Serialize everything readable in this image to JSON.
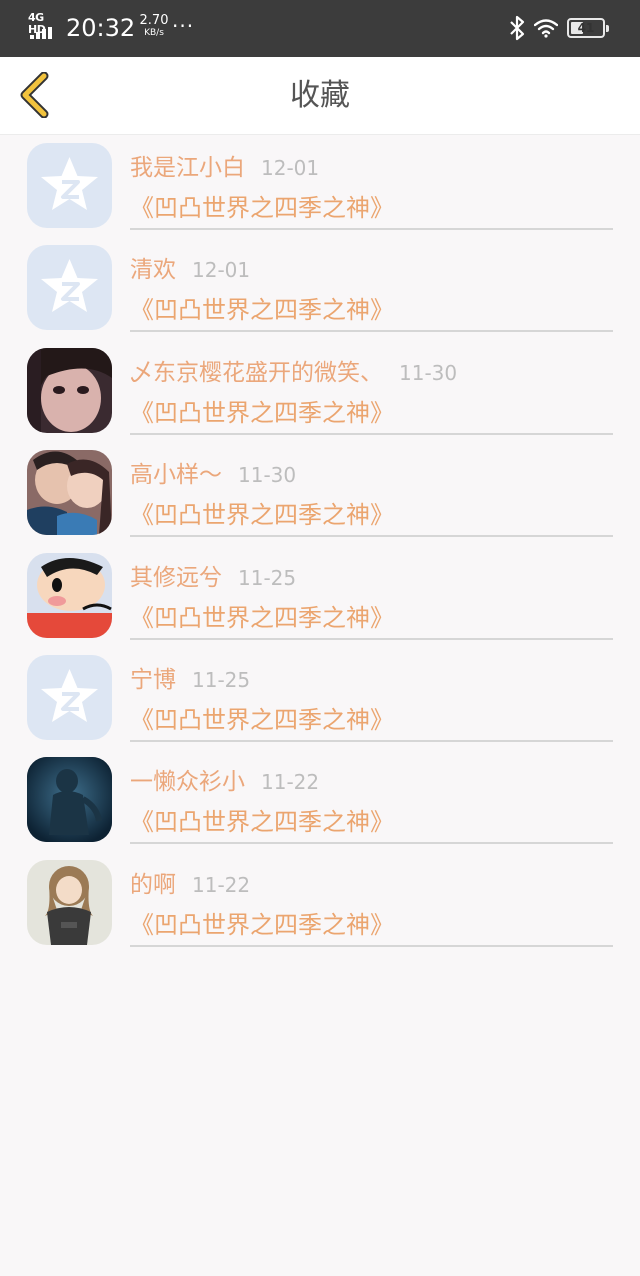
{
  "status_bar": {
    "network": "4G HD",
    "time": "20:32",
    "speed_value": "2.70",
    "speed_unit": "KB/s",
    "more": "···",
    "battery": "41",
    "battery_level": 0.41
  },
  "header": {
    "title": "收藏",
    "back_icon": "chevron-left-icon",
    "back_color": "#f2c33d"
  },
  "favorites": [
    {
      "name": "我是江小白",
      "date": "12-01",
      "book": "《凹凸世界之四季之神》",
      "avatar": "default-qq-avatar"
    },
    {
      "name": "清欢",
      "date": "12-01",
      "book": "《凹凸世界之四季之神》",
      "avatar": "default-qq-avatar"
    },
    {
      "name": "乄东京樱花盛开的微笑、",
      "date": "11-30",
      "book": "《凹凸世界之四季之神》",
      "avatar": "girl-photo-avatar"
    },
    {
      "name": "高小样～",
      "date": "11-30",
      "book": "《凹凸世界之四季之神》",
      "avatar": "couple-photo-avatar"
    },
    {
      "name": "其修远兮",
      "date": "11-25",
      "book": "《凹凸世界之四季之神》",
      "avatar": "cartoon-boy-avatar"
    },
    {
      "name": "宁博",
      "date": "11-25",
      "book": "《凹凸世界之四季之神》",
      "avatar": "default-qq-avatar"
    },
    {
      "name": "一懒众衫小",
      "date": "11-22",
      "book": "《凹凸世界之四季之神》",
      "avatar": "dark-figure-avatar"
    },
    {
      "name": "的啊",
      "date": "11-22",
      "book": "《凹凸世界之四季之神》",
      "avatar": "anime-girl-avatar"
    }
  ],
  "colors": {
    "name": "#eba77b",
    "book": "#eba56f",
    "date": "#bdbdbd",
    "background": "#f9f7f8",
    "default_avatar_bg": "#dde6f3"
  }
}
